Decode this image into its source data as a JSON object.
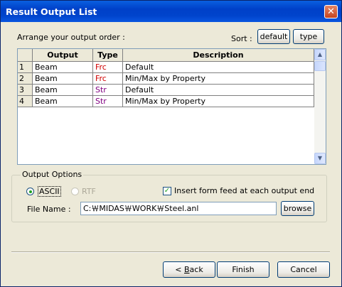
{
  "window": {
    "title": "Result Output List",
    "close_glyph": "✕"
  },
  "arrange_label": "Arrange your output order :",
  "sort": {
    "label": "Sort :",
    "default_button": "default",
    "type_button": "type"
  },
  "table": {
    "columns": [
      "Output",
      "Type",
      "Description"
    ],
    "rows": [
      {
        "num": "1",
        "output": "Beam",
        "type": "Frc",
        "description": "Default"
      },
      {
        "num": "2",
        "output": "Beam",
        "type": "Frc",
        "description": "Min/Max by Property"
      },
      {
        "num": "3",
        "output": "Beam",
        "type": "Str",
        "description": "Default"
      },
      {
        "num": "4",
        "output": "Beam",
        "type": "Str",
        "description": "Min/Max by Property"
      }
    ]
  },
  "output_options": {
    "legend": "Output Options",
    "ascii_label": "ASCII",
    "rtf_label": "RTF",
    "formfeed_label": "Insert form feed at each output end",
    "formfeed_checked": true,
    "file_name_label": "File Name :",
    "file_name_value": "C:￦MIDAS￦WORK￦Steel.anl",
    "browse_button": "browse"
  },
  "footer": {
    "back_prefix": "< ",
    "back_key": "B",
    "back_rest": "ack",
    "finish": "Finish",
    "cancel": "Cancel"
  },
  "colors": {
    "frc": "#d00000",
    "str": "#800080"
  }
}
